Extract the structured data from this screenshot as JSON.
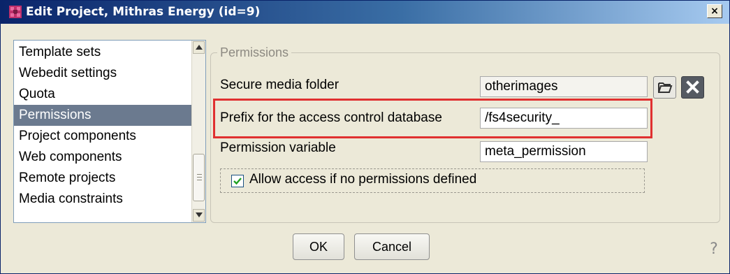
{
  "window": {
    "title": "Edit Project, Mithras Energy (id=9)",
    "close_label": "×"
  },
  "nav": {
    "items": [
      {
        "label": "Template sets"
      },
      {
        "label": "Webedit settings"
      },
      {
        "label": "Quota"
      },
      {
        "label": "Permissions",
        "selected": true
      },
      {
        "label": "Project components"
      },
      {
        "label": "Web components"
      },
      {
        "label": "Remote projects"
      },
      {
        "label": "Media constraints"
      }
    ]
  },
  "permissions": {
    "group_title": "Permissions",
    "secure_media_folder": {
      "label": "Secure media folder",
      "value": "otherimages"
    },
    "prefix": {
      "label": "Prefix for the access control database",
      "value": "/fs4security_"
    },
    "permission_variable": {
      "label": "Permission variable",
      "value": "meta_permission"
    },
    "allow_access": {
      "label": "Allow access if no permissions defined",
      "checked": true
    }
  },
  "footer": {
    "ok_label": "OK",
    "cancel_label": "Cancel",
    "help_label": "?"
  },
  "colors": {
    "title_gradient_start": "#0a246a",
    "selection": "#6b7a8f",
    "highlight": "#e03030"
  }
}
